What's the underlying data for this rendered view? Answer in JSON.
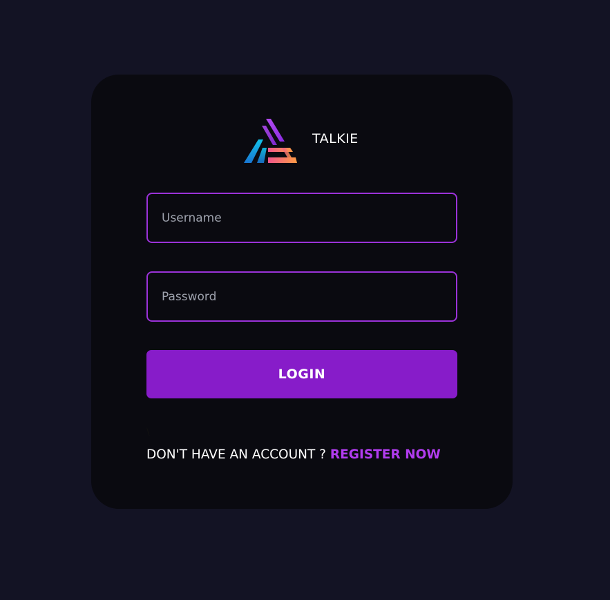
{
  "brand": {
    "logo_icon": "triangle-logo-icon",
    "name": "TALKIE"
  },
  "form": {
    "username_placeholder": "Username",
    "username_value": "",
    "password_placeholder": "Password",
    "password_value": "",
    "login_label": "LOGIN"
  },
  "stray_text": "\\",
  "footer": {
    "prompt": "DON'T HAVE AN ACCOUNT ?",
    "link_label": "REGISTER NOW"
  },
  "colors": {
    "page_background": "#131324",
    "card_background": "#0a0a10",
    "accent_border": "#9b32d9",
    "button": "#871cc9",
    "link": "#b23cf0"
  }
}
